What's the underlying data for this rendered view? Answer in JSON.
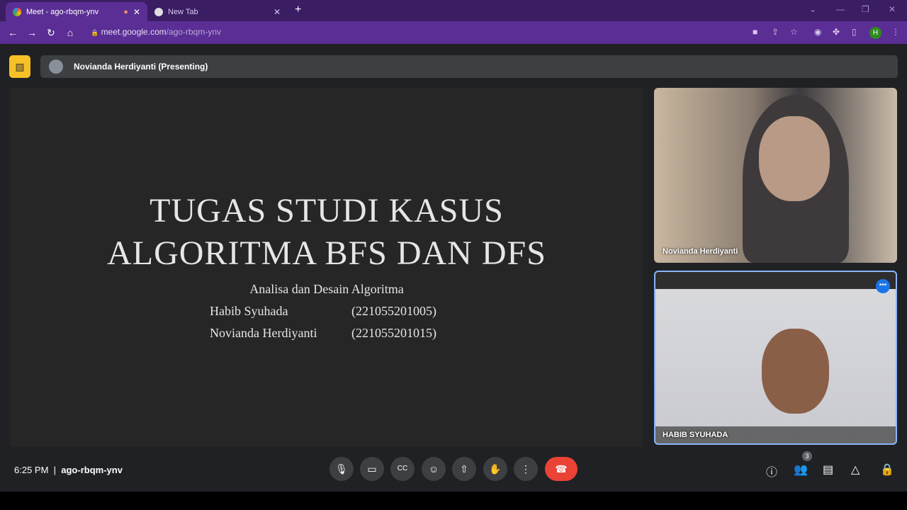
{
  "browser": {
    "tabs": [
      {
        "label": "Meet - ago-rbqm-ynv"
      },
      {
        "label": "New Tab"
      }
    ],
    "url_host": "meet.google.com",
    "url_path": "/ago-rbqm-ynv",
    "profile_initial": "H"
  },
  "meet": {
    "presenter_label": "Novianda Herdiyanti (Presenting)",
    "time": "6:25 PM",
    "meeting_code": "ago-rbqm-ynv",
    "participant_count": "3",
    "slide": {
      "title_line1": "TUGAS STUDI KASUS",
      "title_line2": "ALGORITMA BFS DAN DFS",
      "subtitle": "Analisa dan Desain Algoritma",
      "members": [
        {
          "name": "Habib Syuhada",
          "id": "(221055201005)"
        },
        {
          "name": "Novianda Herdiyanti",
          "id": "(221055201015)"
        }
      ]
    },
    "participants": [
      {
        "name": "Novianda Herdiyanti"
      },
      {
        "name": "HABIB SYUHADA"
      }
    ]
  }
}
